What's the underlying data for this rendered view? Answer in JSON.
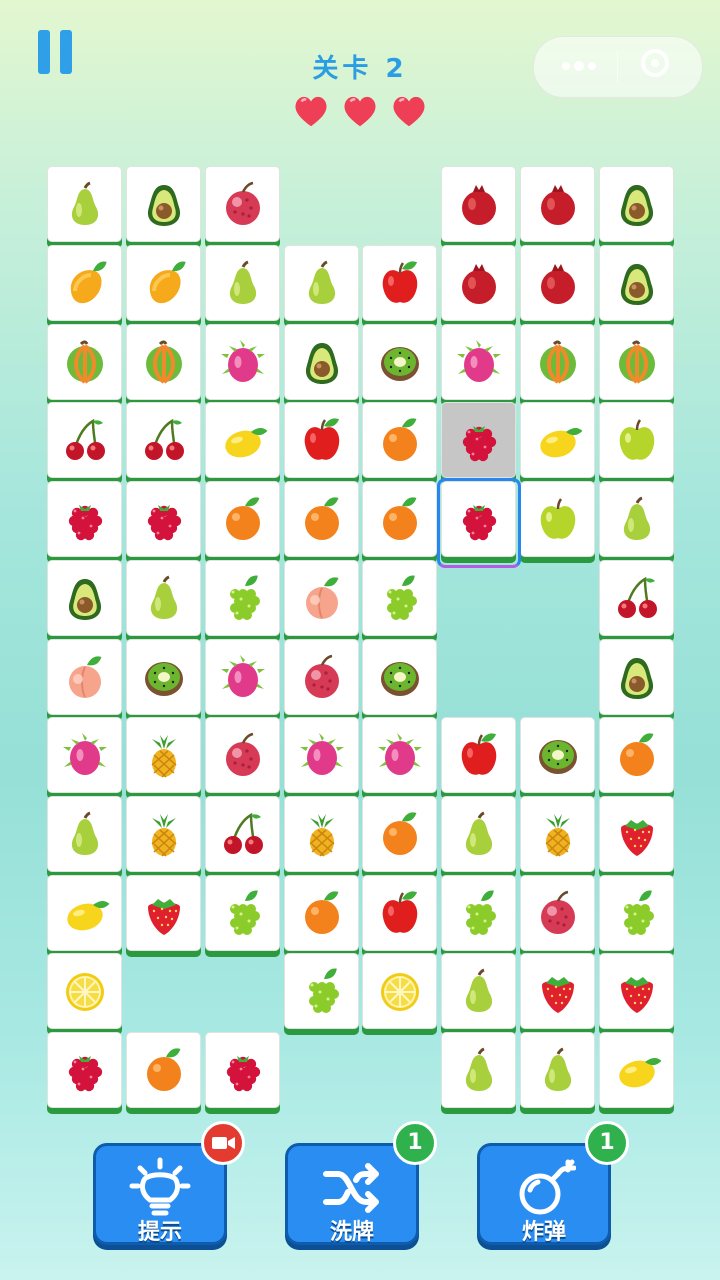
{
  "header": {
    "level_text": "关卡 2",
    "lives": 3,
    "heart_color": "#ef3f56"
  },
  "tile_style": {
    "face": "#ffffff",
    "edge": "#2b9a3f",
    "dim": "#c6c6c6"
  },
  "board": {
    "rows": [
      [
        "pear",
        "avocado",
        "lychee",
        null,
        null,
        "pomegranate",
        "pomegranate",
        "avocado"
      ],
      [
        "mango",
        "mango",
        "pear",
        "pear",
        "apple",
        "pomegranate",
        "pomegranate",
        "avocado"
      ],
      [
        "melon",
        "melon",
        "dragonfruit",
        "avocado",
        "kiwi",
        "dragonfruit",
        "melon",
        "melon"
      ],
      [
        "cherry",
        "cherry",
        "lemon",
        "apple",
        "orange",
        "raspberry",
        "lemon",
        "green-apple"
      ],
      [
        "raspberry",
        "raspberry",
        "orange",
        "orange",
        "orange",
        "raspberry",
        "green-apple",
        "pear"
      ],
      [
        "avocado",
        "pear",
        "grapes",
        "peach",
        "grapes",
        null,
        null,
        "cherry"
      ],
      [
        "peach",
        "kiwi",
        "dragonfruit",
        "lychee",
        "kiwi",
        null,
        null,
        "avocado"
      ],
      [
        "dragonfruit",
        "pineapple",
        "lychee",
        "dragonfruit",
        "dragonfruit",
        "apple",
        "kiwi",
        "orange"
      ],
      [
        "pear",
        "pineapple",
        "cherry",
        "pineapple",
        "orange",
        "pear",
        "pineapple",
        "strawberry"
      ],
      [
        "lemon",
        "strawberry",
        "grapes",
        "orange",
        "apple",
        "grapes",
        "lychee",
        "grapes"
      ],
      [
        "lemon-slice",
        null,
        null,
        "grapes",
        "lemon-slice",
        "pear",
        "strawberry",
        "strawberry"
      ],
      [
        "raspberry",
        "orange",
        "raspberry",
        null,
        null,
        "pear",
        "pear",
        "lemon"
      ]
    ],
    "dimmed_tile": [
      3,
      5
    ],
    "selected_tile": [
      4,
      5
    ],
    "selection_colors": [
      "#2a86ef",
      "#b35ce6"
    ]
  },
  "powerups": [
    {
      "name": "hint",
      "label": "提示",
      "icon": "lightbulb-icon",
      "badge_type": "video",
      "badge_text": ""
    },
    {
      "name": "shuffle",
      "label": "洗牌",
      "icon": "shuffle-icon",
      "badge_type": "count",
      "badge_text": "1"
    },
    {
      "name": "bomb",
      "label": "炸弹",
      "icon": "bomb-icon",
      "badge_type": "count",
      "badge_text": "1"
    }
  ],
  "button_color": "#2a8df2",
  "badge_color": "#2fb24e"
}
